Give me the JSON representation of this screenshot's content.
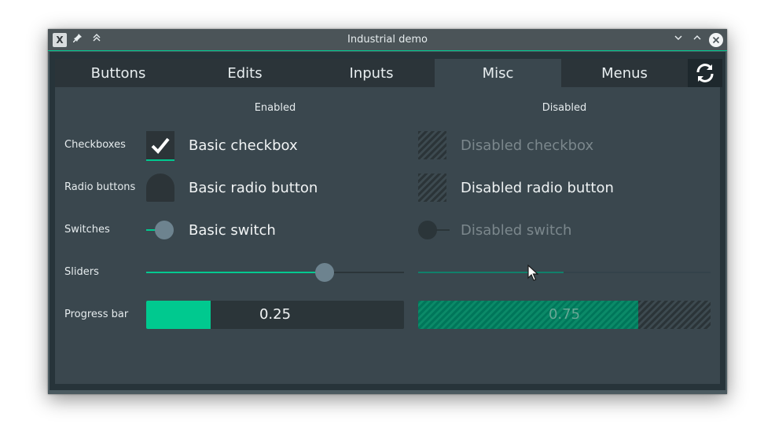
{
  "window": {
    "title": "Industrial demo",
    "icon": "x-window-icon",
    "accent": "#00c98f"
  },
  "tabs": [
    {
      "label": "Buttons",
      "active": false
    },
    {
      "label": "Edits",
      "active": false
    },
    {
      "label": "Inputs",
      "active": false
    },
    {
      "label": "Misc",
      "active": true
    },
    {
      "label": "Menus",
      "active": false
    }
  ],
  "columns": {
    "enabled": "Enabled",
    "disabled": "Disabled"
  },
  "rows": {
    "checkboxes": "Checkboxes",
    "radio_buttons": "Radio buttons",
    "switches": "Switches",
    "sliders": "Sliders",
    "progress_bar": "Progress bar"
  },
  "controls": {
    "checkbox_enabled": {
      "label": "Basic checkbox",
      "checked": true
    },
    "checkbox_disabled": {
      "label": "Disabled checkbox",
      "checked": false
    },
    "radio_enabled": {
      "label": "Basic radio button",
      "checked": false
    },
    "radio_disabled": {
      "label": "Disabled radio button",
      "checked": false
    },
    "switch_enabled": {
      "label": "Basic switch",
      "on": false
    },
    "switch_disabled": {
      "label": "Disabled switch",
      "on": false
    },
    "slider_enabled": {
      "value_fraction": 0.69
    },
    "slider_disabled": {
      "value_fraction": 0.5
    },
    "progress_enabled": {
      "value": 0.25,
      "text": "0.25"
    },
    "progress_disabled": {
      "value": 0.75,
      "text": "0.75"
    }
  }
}
